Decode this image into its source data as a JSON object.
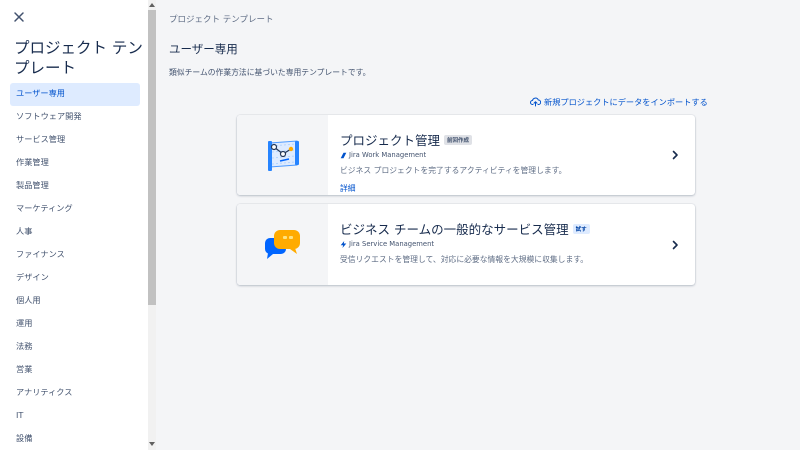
{
  "sidebar": {
    "title": "プロジェクト テンプレート",
    "items": [
      {
        "label": "ユーザー専用",
        "active": true
      },
      {
        "label": "ソフトウェア開発"
      },
      {
        "label": "サービス管理"
      },
      {
        "label": "作業管理"
      },
      {
        "label": "製品管理"
      },
      {
        "label": "マーケティング"
      },
      {
        "label": "人事"
      },
      {
        "label": "ファイナンス"
      },
      {
        "label": "デザイン"
      },
      {
        "label": "個人用"
      },
      {
        "label": "運用"
      },
      {
        "label": "法務"
      },
      {
        "label": "営業"
      },
      {
        "label": "アナリティクス"
      },
      {
        "label": "IT"
      },
      {
        "label": "設備"
      }
    ]
  },
  "main": {
    "breadcrumb": "プロジェクト テンプレート",
    "title": "ユーザー専用",
    "description": "類似チームの作業方法に基づいた専用テンプレートです。",
    "import_link": "新規プロジェクトにデータをインポートする",
    "cards": [
      {
        "title": "プロジェクト管理",
        "badge": "前回作成",
        "product": "Jira Work Management",
        "description": "ビジネス プロジェクトを完了するアクティビティを管理します。",
        "link": "詳細"
      },
      {
        "title": "ビジネス チームの一般的なサービス管理",
        "badge": "試す",
        "product": "Jira Service Management",
        "description": "受信リクエストを管理して、対応に必要な情報を大規模に収集します。"
      }
    ]
  },
  "colors": {
    "accent": "#0052cc",
    "active_bg": "#deebff",
    "page_bg": "#f4f5f7",
    "text": "#172b4d",
    "subtle_text": "#42526e"
  },
  "icons": {
    "close": "close-icon",
    "import": "cloud-upload-icon",
    "work_management": "jira-work-management-icon",
    "service_management": "jira-service-management-icon",
    "chevron": "chevron-right-icon"
  }
}
